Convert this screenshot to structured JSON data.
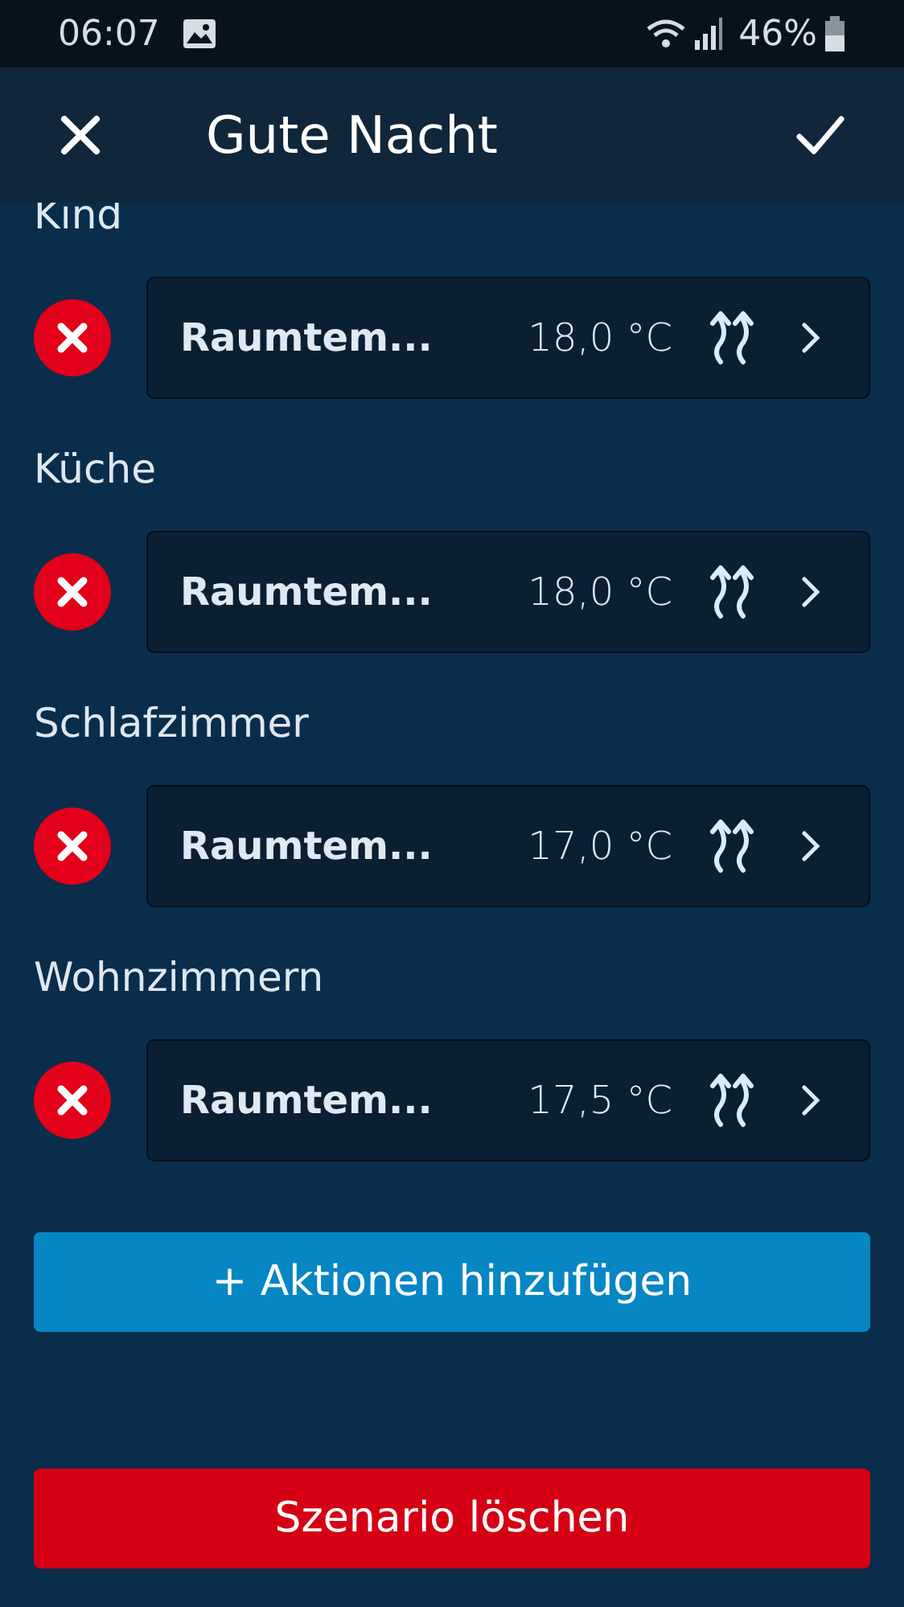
{
  "status_bar": {
    "time": "06:07",
    "battery": "46%"
  },
  "header": {
    "title": "Gute Nacht"
  },
  "rooms": [
    {
      "name": "Kind",
      "action": {
        "label": "Raumtem...",
        "value": "18,0 °C"
      }
    },
    {
      "name": "Küche",
      "action": {
        "label": "Raumtem...",
        "value": "18,0 °C"
      }
    },
    {
      "name": "Schlafzimmer",
      "action": {
        "label": "Raumtem...",
        "value": "17,0 °C"
      }
    },
    {
      "name": "Wohnzimmern",
      "action": {
        "label": "Raumtem...",
        "value": "17,5 °C"
      }
    }
  ],
  "add_button": "+ Aktionen hinzufügen",
  "delete_button": "Szenario löschen"
}
